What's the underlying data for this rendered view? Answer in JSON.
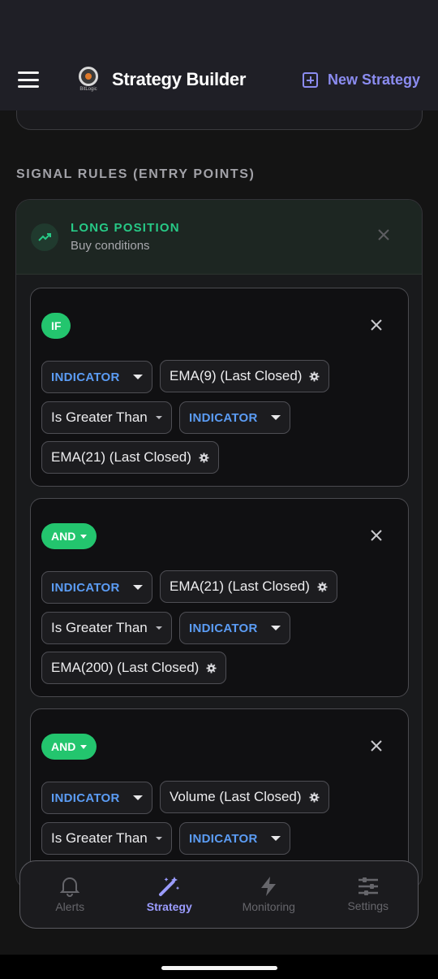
{
  "header": {
    "title": "Strategy Builder",
    "logo_text": "BitLogic",
    "new_strategy_label": "New Strategy"
  },
  "section": {
    "title": "SIGNAL RULES (ENTRY POINTS)"
  },
  "long_position": {
    "title": "LONG POSITION",
    "subtitle": "Buy conditions",
    "accent": "#27c986"
  },
  "rules": [
    {
      "logic": "IF",
      "left_type": "INDICATOR",
      "left_value": "EMA(9) (Last Closed)",
      "operator": "Is Greater Than",
      "right_type": "INDICATOR",
      "right_value": "EMA(21) (Last Closed)"
    },
    {
      "logic": "AND",
      "left_type": "INDICATOR",
      "left_value": "EMA(21) (Last Closed)",
      "operator": "Is Greater Than",
      "right_type": "INDICATOR",
      "right_value": "EMA(200) (Last Closed)"
    },
    {
      "logic": "AND",
      "left_type": "INDICATOR",
      "left_value": "Volume (Last Closed)",
      "operator": "Is Greater Than",
      "right_type": "INDICATOR"
    }
  ],
  "nav": [
    {
      "label": "Alerts",
      "icon": "bell-icon"
    },
    {
      "label": "Strategy",
      "icon": "magic-wand-icon",
      "active": true
    },
    {
      "label": "Monitoring",
      "icon": "lightning-icon"
    },
    {
      "label": "Settings",
      "icon": "sliders-icon"
    }
  ],
  "colors": {
    "accent": "#8b8cf0",
    "pill_green": "#23c56e",
    "indicator_blue": "#5b9cf4"
  }
}
